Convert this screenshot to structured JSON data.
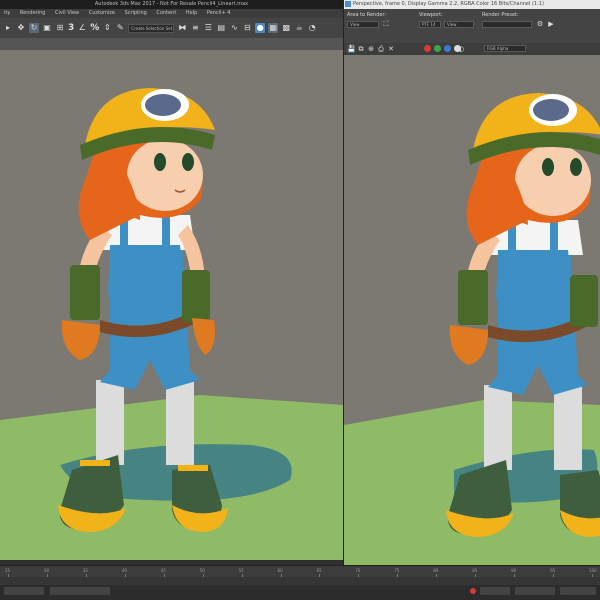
{
  "app": {
    "title": "Autodesk 3ds Max 2017 - Not For Resale   Pencil4_Lineart.max"
  },
  "menubar": {
    "items": [
      "ity",
      "Rendering",
      "Civil View",
      "Customize",
      "Scripting",
      "Content",
      "Help",
      "Pencil+ 4"
    ]
  },
  "toolbar": {
    "angle_snap": "3",
    "percent_snap": "%",
    "selection_set": "Create Selection Set"
  },
  "render_window": {
    "title": "Perspective, frame 0, Display Gamma 2.2, RGBA Color 16 Bits/Channel (1:1)",
    "area_label": "Area to Render:",
    "area_value": "View",
    "viewport_label": "Viewport:",
    "viewport_value": "PTF 14",
    "viewport_extra": "View",
    "preset_label": "Render Preset:",
    "preset_value": "",
    "channel_value": "RGB Alpha"
  },
  "timeline": {
    "ticks": [
      "25",
      "30",
      "35",
      "40",
      "45",
      "50",
      "55",
      "60",
      "65",
      "70",
      "75",
      "80",
      "85",
      "90",
      "95",
      "100"
    ]
  },
  "icons": {
    "window_icon": "render-window-icon",
    "swatch_colors": [
      "#d83a3a",
      "#3aa84a",
      "#3a7ad8",
      "#dddddd"
    ]
  }
}
